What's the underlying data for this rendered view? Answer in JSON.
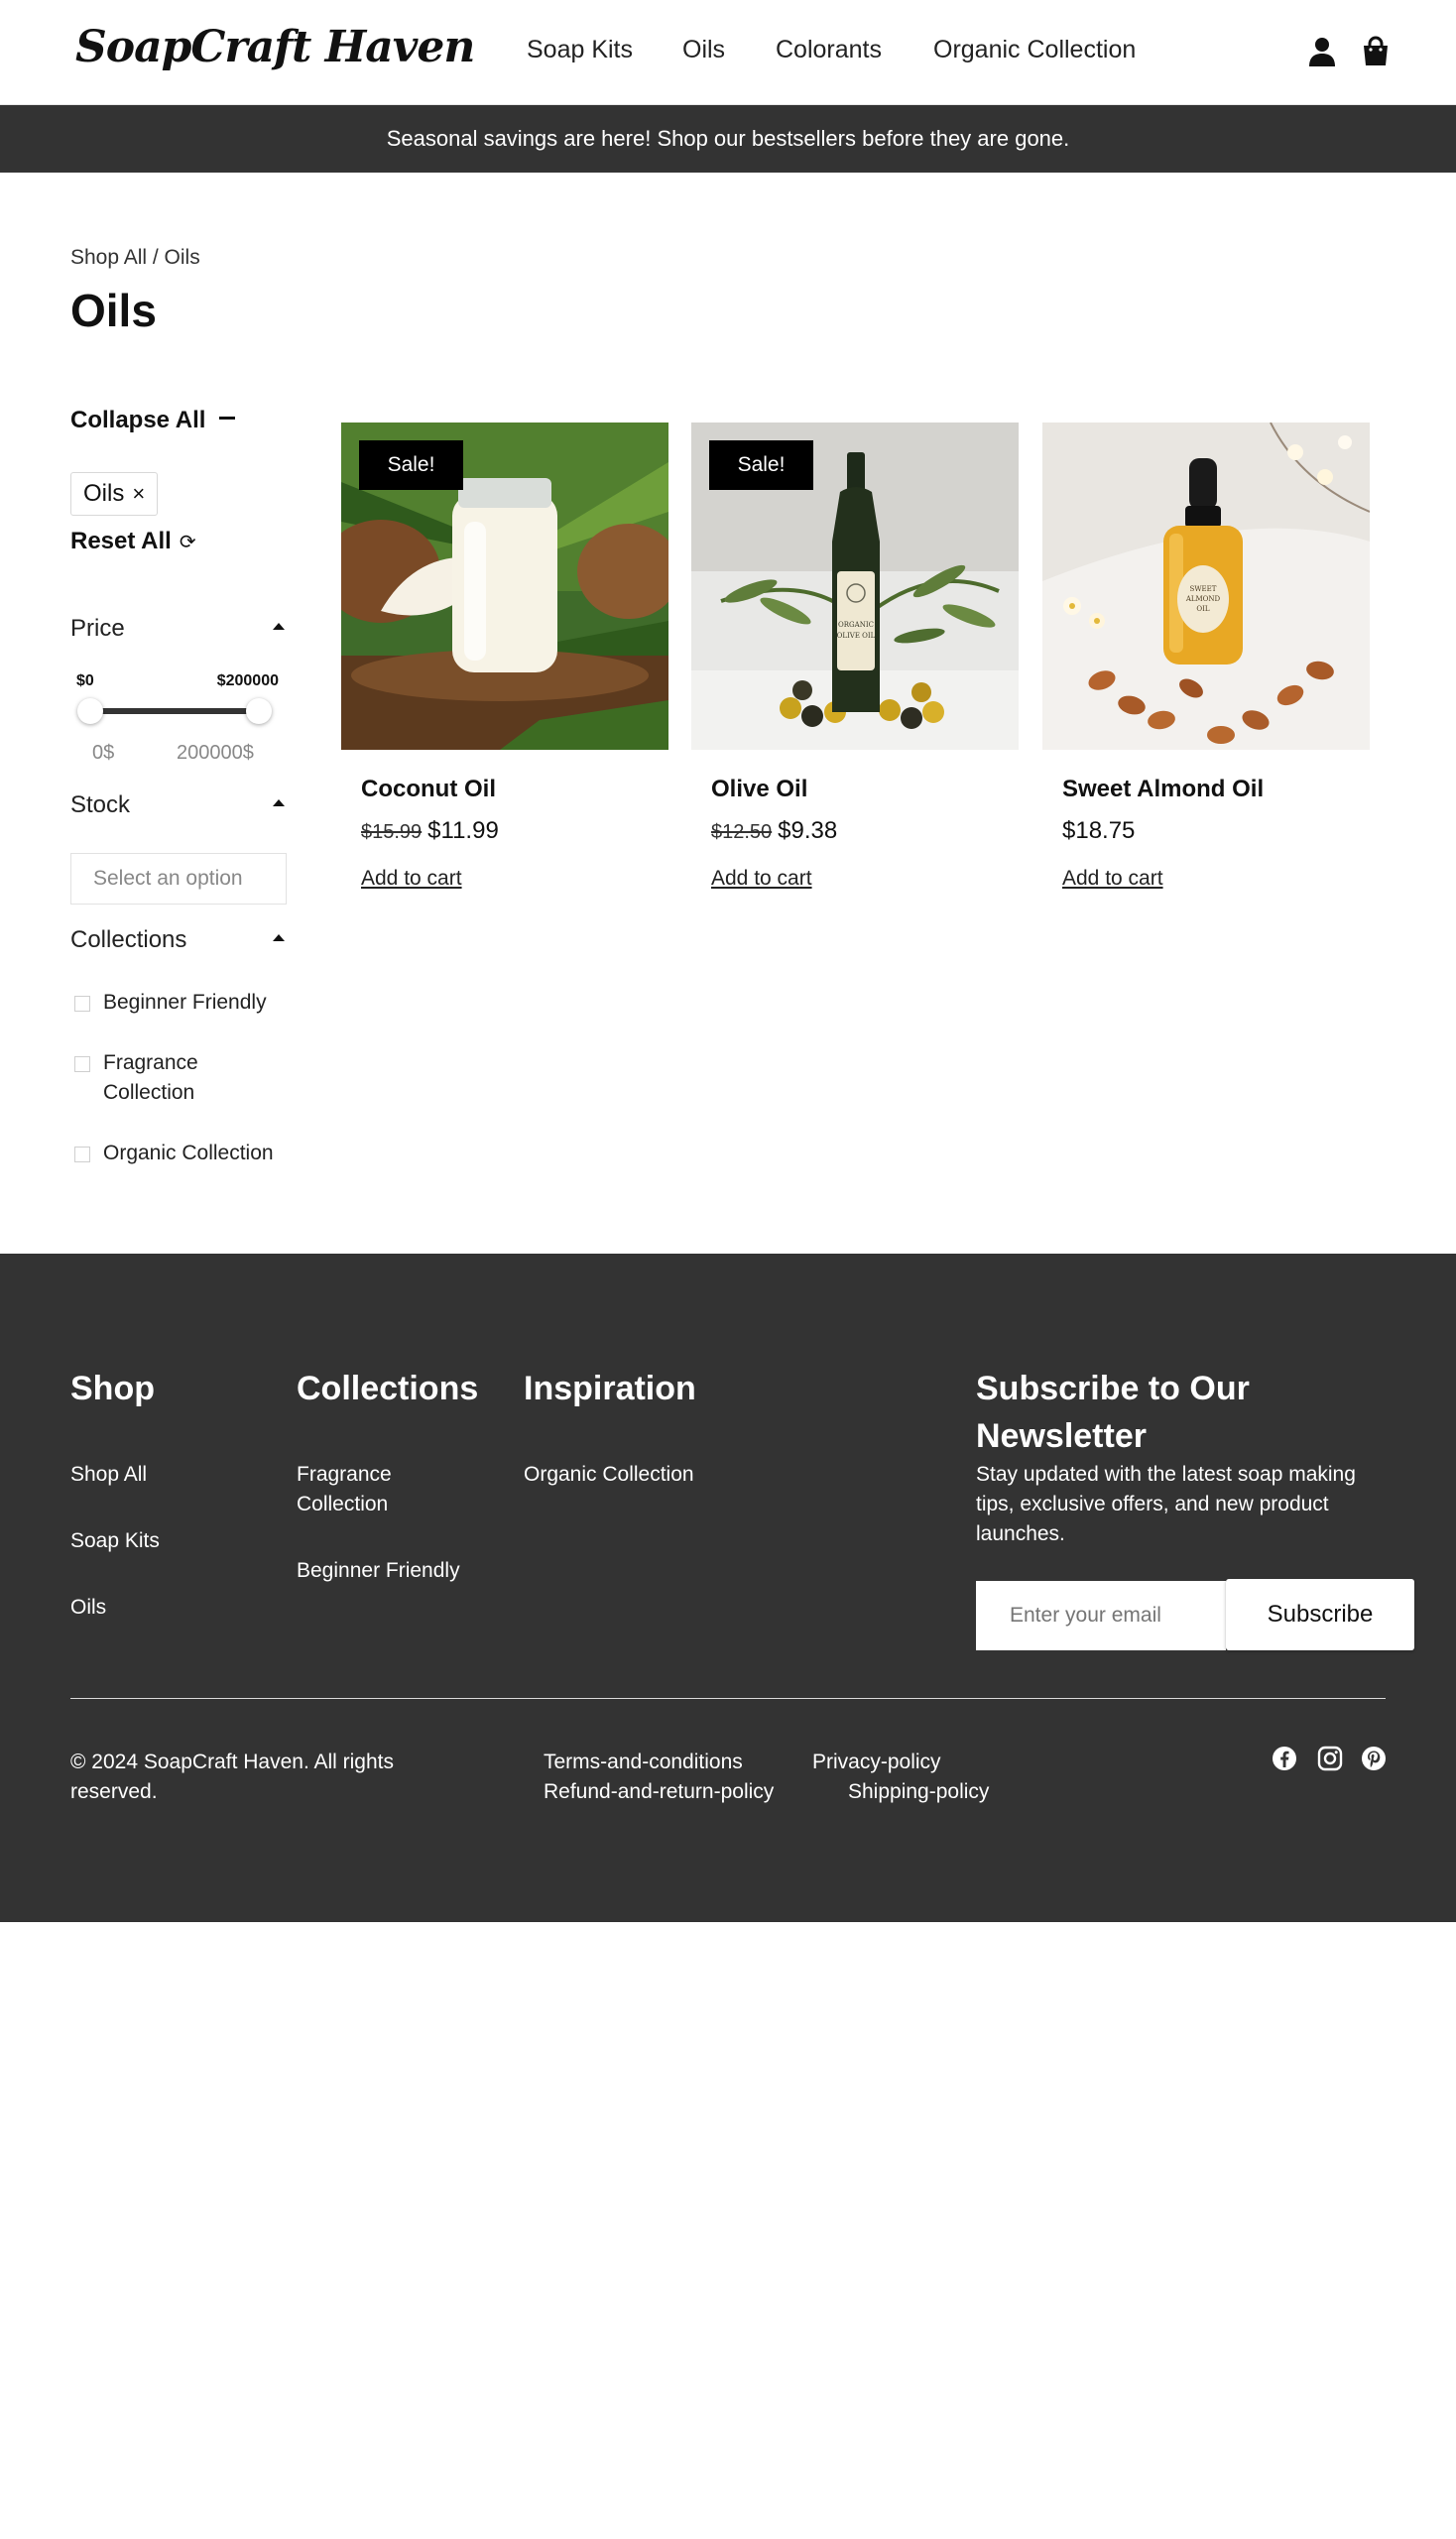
{
  "header": {
    "logo": "SoapCraft Haven",
    "nav": [
      "Soap Kits",
      "Oils",
      "Colorants",
      "Organic Collection"
    ],
    "icons": [
      "account-icon",
      "cart-icon"
    ]
  },
  "announcement": "Seasonal savings are here! Shop our bestsellers before they are gone.",
  "page": {
    "breadcrumb": "Shop All / Oils",
    "title": "Oils"
  },
  "filters": {
    "collapse_all": "Collapse All",
    "active_chip": "Oils",
    "chip_remove": "×",
    "reset_all": "Reset All",
    "reset_icon": "⟳",
    "price": {
      "label": "Price",
      "min_label": "$0",
      "max_label": "$200000",
      "min_readout": "0$",
      "max_readout": "200000$",
      "selected_min_fraction": 0,
      "selected_max_fraction": 1
    },
    "stock": {
      "label": "Stock",
      "placeholder": "Select an option"
    },
    "collections": {
      "label": "Collections",
      "options": [
        "Beginner Friendly",
        "Fragrance Collection",
        "Organic Collection"
      ]
    }
  },
  "products": [
    {
      "name": "Coconut Oil",
      "badge": "Sale!",
      "old_price": "$15.99",
      "price": "$11.99",
      "cta": "Add to cart"
    },
    {
      "name": "Olive Oil",
      "badge": "Sale!",
      "old_price": "$12.50",
      "price": "$9.38",
      "cta": "Add to cart"
    },
    {
      "name": "Sweet Almond Oil",
      "badge": "",
      "old_price": "",
      "price": "$18.75",
      "cta": "Add to cart"
    }
  ],
  "product_images": {
    "olive_label": "ORGANIC OLIVE OIL",
    "almond_label": "SWEET ALMOND OIL"
  },
  "footer": {
    "shop": {
      "heading": "Shop",
      "links": [
        "Shop All",
        "Soap Kits",
        "Oils"
      ]
    },
    "collections": {
      "heading": "Collections",
      "links": [
        "Fragrance Collection",
        "Beginner Friendly"
      ]
    },
    "inspiration": {
      "heading": "Inspiration",
      "links": [
        "Organic Collection"
      ]
    },
    "newsletter": {
      "heading": "Subscribe to Our Newsletter",
      "text": "Stay updated with the latest soap making tips, exclusive offers, and new product launches.",
      "placeholder": "Enter your email",
      "button": "Subscribe"
    },
    "copyright": "© 2024 SoapCraft Haven. All rights reserved.",
    "legal": [
      "Terms-and-conditions",
      "Privacy-policy",
      "Refund-and-return-policy",
      "Shipping-policy"
    ],
    "social": [
      "facebook-icon",
      "instagram-icon",
      "pinterest-icon"
    ]
  },
  "colors": {
    "dark": "#333333",
    "badge": "#000000",
    "text": "#111111",
    "muted": "#888888"
  }
}
